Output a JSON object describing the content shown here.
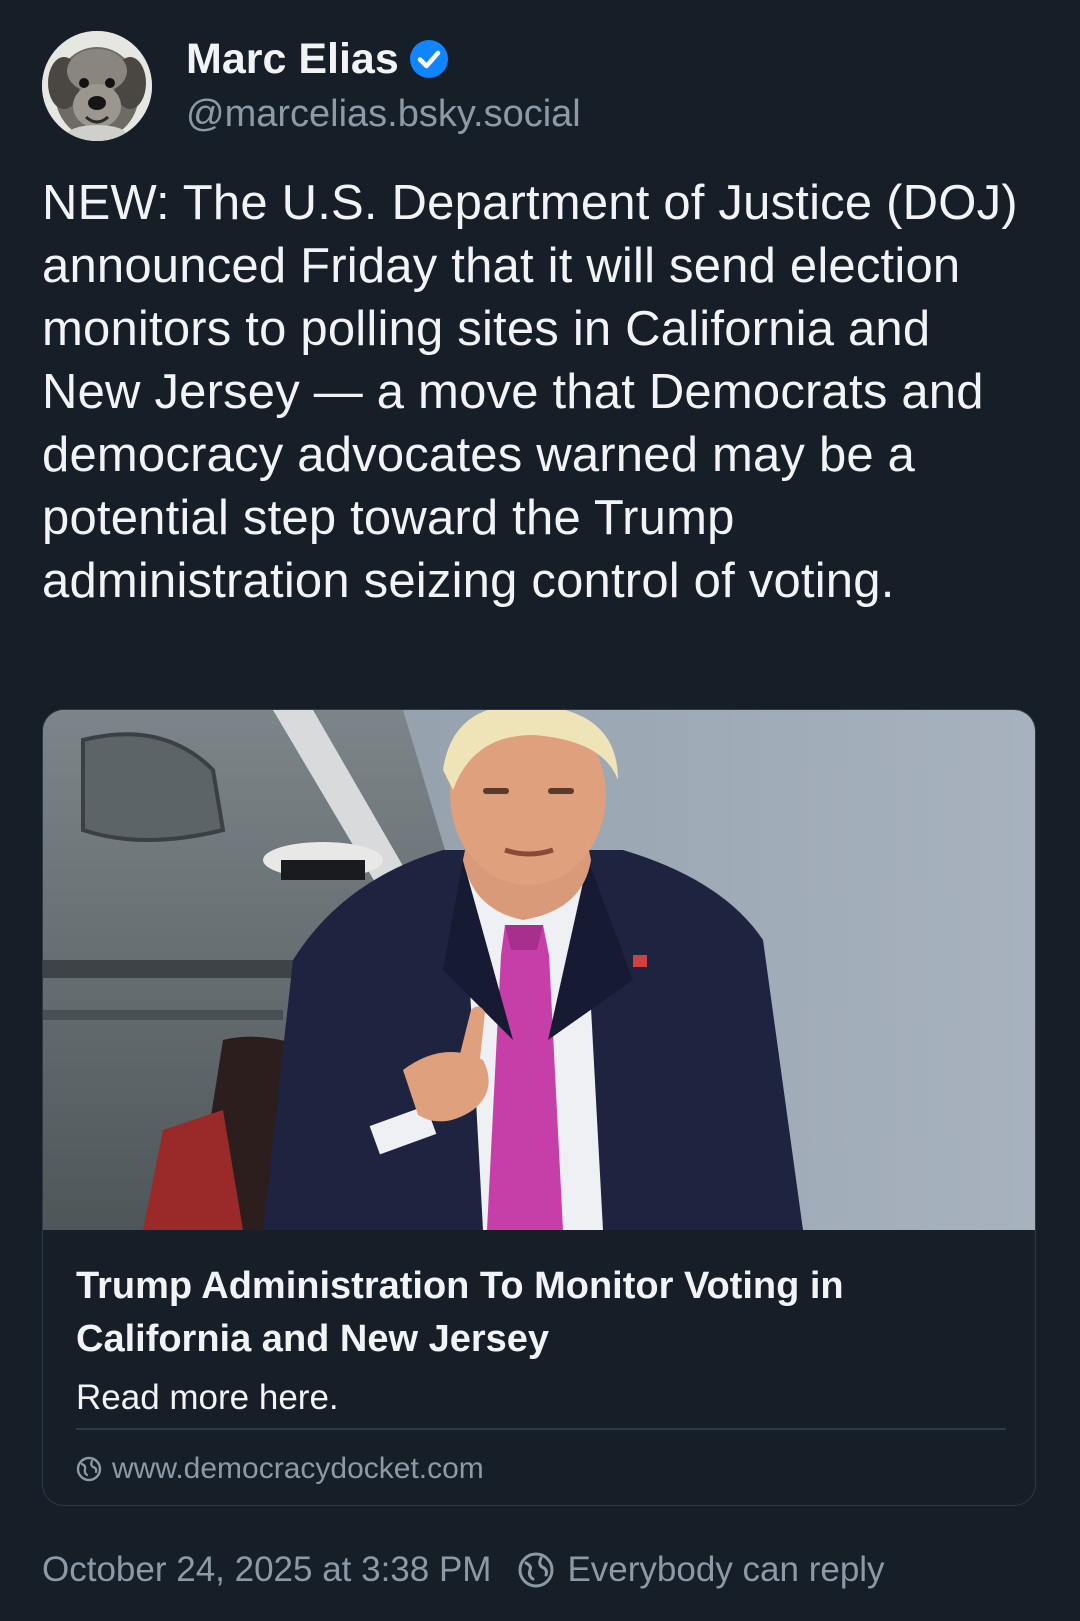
{
  "author": {
    "display_name": "Marc Elias",
    "handle": "@marcelias.bsky.social",
    "verified_icon": "verified-check-icon",
    "avatar_icon": "dog-avatar"
  },
  "post": {
    "text": "NEW: The U.S. Department of Justice (DOJ) announced Friday that it will send election monitors to polling sites in California and New Jersey — a move that Democrats and democracy advocates warned may be a potential step toward the Trump administration seizing control of voting."
  },
  "link_card": {
    "title": "Trump Administration To Monitor Voting in California and New Jersey",
    "description": "Read more here.",
    "domain": "www.democracydocket.com",
    "domain_icon": "globe-icon"
  },
  "footer": {
    "timestamp": "October 24, 2025 at 3:38 PM",
    "reply_setting": "Everybody can reply",
    "reply_icon": "globe-icon"
  },
  "colors": {
    "background": "#161e27",
    "text_primary": "#f1f3f5",
    "text_secondary": "#8c9aa8",
    "border": "#2e3a47",
    "verified_blue": "#1185fe",
    "tie_pink": "#c63fa8"
  }
}
